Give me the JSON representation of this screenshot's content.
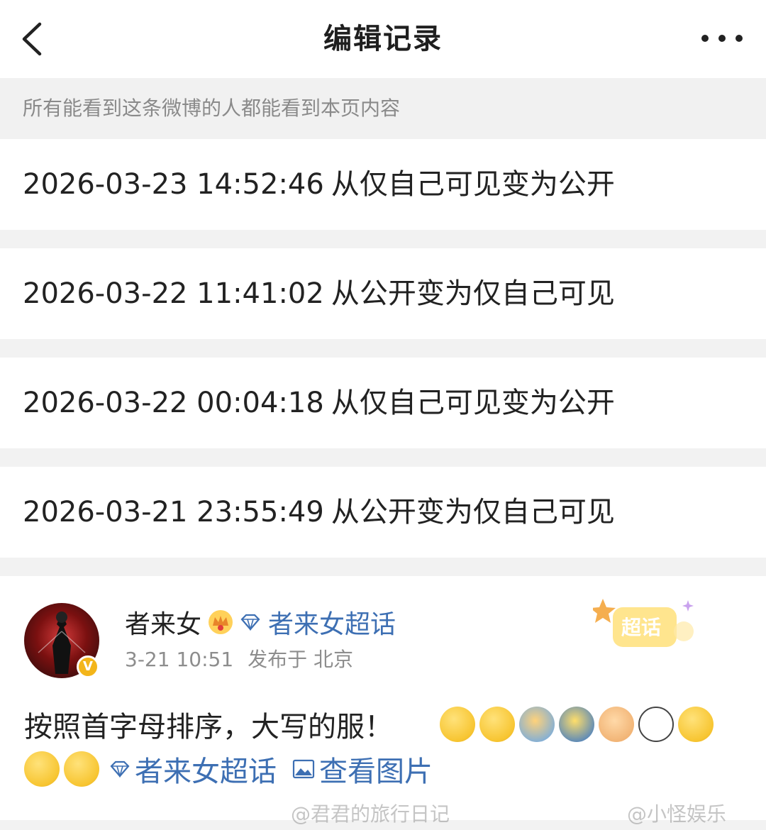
{
  "header": {
    "title": "编辑记录",
    "back_icon": "chevron-left-icon",
    "more_icon": "more-horizontal-icon"
  },
  "notice": "所有能看到这条微博的人都能看到本页内容",
  "records": [
    {
      "time": "2026-03-23 14:52:46",
      "action": "从仅自己可见变为公开"
    },
    {
      "time": "2026-03-22 11:41:02",
      "action": "从公开变为仅自己可见"
    },
    {
      "time": "2026-03-22 00:04:18",
      "action": "从仅自己可见变为公开"
    },
    {
      "time": "2026-03-21 23:55:49",
      "action": "从公开变为仅自己可见"
    }
  ],
  "post": {
    "author": "者来女",
    "verified_badge": "V",
    "topic_link": "者来女超话",
    "time": "3-21 10:51",
    "location": "发布于 北京",
    "sticker_text": "超话",
    "text": "按照首字母排序，大写的服！",
    "emojis_line1": [
      "cover-mouth-emoji",
      "laugh-cry-emoji",
      "raise-hand-emoji",
      "push-emoji",
      "clap-hands-emoji",
      "cat-emoji",
      "thinking-emoji"
    ],
    "emojis_line2": [
      "dizzy-emoji",
      "dizzy-emoji"
    ],
    "topic_link_inline": "者来女超话",
    "view_image": "查看图片"
  },
  "watermarks": [
    "@君君的旅行日记",
    "@小怪娱乐"
  ],
  "colors": {
    "link": "#3d6fb3",
    "separator_bg": "#f2f2f2",
    "muted_text": "#8a8a8a",
    "badge": "#f3b51a"
  }
}
